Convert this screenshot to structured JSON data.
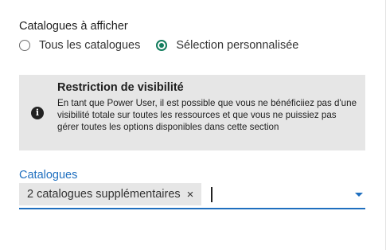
{
  "catalogues_section": {
    "title": "Catalogues à afficher",
    "options": [
      {
        "label": "Tous les catalogues",
        "selected": false
      },
      {
        "label": "Sélection personnalisée",
        "selected": true
      }
    ]
  },
  "info_box": {
    "icon": "info-icon",
    "title": "Restriction de visibilité",
    "text": "En tant que Power User, il est possible que vous ne bénéficiiez pas d'une visibilité totale sur toutes les ressources et que vous ne puissiez pas gérer toutes les options disponibles dans cette section"
  },
  "catalogues_field": {
    "label": "Catalogues",
    "chip_label": "2 catalogues supplémentaires",
    "chip_remove_icon": "×",
    "value": ""
  },
  "colors": {
    "accent_green": "#137d5d",
    "accent_blue": "#1f6fbf",
    "info_background": "#e6e6e6"
  }
}
